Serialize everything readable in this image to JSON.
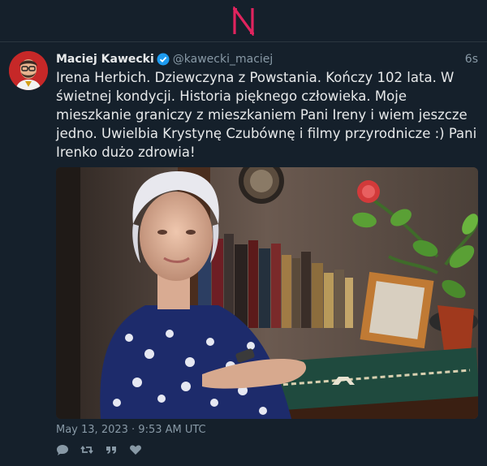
{
  "app": {
    "logo_letter": "N",
    "brand_color": "#e0245e"
  },
  "tweet": {
    "author_name": "Maciej Kawecki",
    "handle": "@kawecki_maciej",
    "relative_time": "6s",
    "verified": true,
    "text": "Irena Herbich. Dziewczyna z Powstania. Kończy 102 lata. W świetnej kondycji. Historia pięknego człowieka. Moje mieszkanie graniczy z mieszkaniem Pani Ireny i wiem jeszcze jedno. Uwielbia Krystynę Czubównę i filmy przyrodnicze :) Pani Irenko dużo zdrowia!",
    "timestamp": "May 13, 2023 · 9:53 AM UTC",
    "actions": [
      "reply-icon",
      "retweet-icon",
      "quote-icon",
      "like-icon"
    ]
  },
  "colors": {
    "background": "#15202b",
    "text": "#e7e9ea",
    "muted": "#8899a6",
    "verified": "#1d9bf0"
  }
}
